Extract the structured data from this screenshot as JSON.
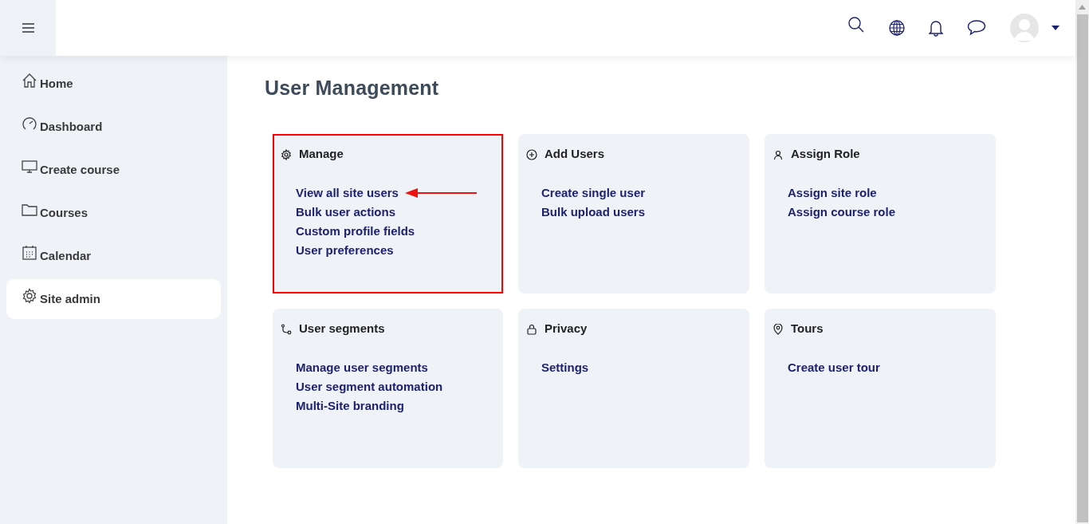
{
  "sidebar": {
    "items": [
      {
        "label": "Home",
        "selected": false
      },
      {
        "label": "Dashboard",
        "selected": false
      },
      {
        "label": "Create course",
        "selected": false
      },
      {
        "label": "Courses",
        "selected": false
      },
      {
        "label": "Calendar",
        "selected": false
      },
      {
        "label": "Site admin",
        "selected": true
      }
    ]
  },
  "page": {
    "title": "User Management"
  },
  "cards": [
    {
      "title": "Manage",
      "highlighted": true,
      "links": [
        {
          "label": "View all site users",
          "pointer_arrow": true
        },
        {
          "label": "Bulk user actions",
          "pointer_arrow": false
        },
        {
          "label": "Custom profile fields",
          "pointer_arrow": false
        },
        {
          "label": "User preferences",
          "pointer_arrow": false
        }
      ]
    },
    {
      "title": "Add Users",
      "highlighted": false,
      "links": [
        {
          "label": "Create single user",
          "pointer_arrow": false
        },
        {
          "label": "Bulk upload users",
          "pointer_arrow": false
        }
      ]
    },
    {
      "title": "Assign Role",
      "highlighted": false,
      "links": [
        {
          "label": "Assign site role",
          "pointer_arrow": false
        },
        {
          "label": "Assign course role",
          "pointer_arrow": false
        }
      ]
    },
    {
      "title": "User segments",
      "highlighted": false,
      "links": [
        {
          "label": "Manage user segments",
          "pointer_arrow": false
        },
        {
          "label": "User segment automation",
          "pointer_arrow": false
        },
        {
          "label": "Multi-Site branding",
          "pointer_arrow": false
        }
      ]
    },
    {
      "title": "Privacy",
      "highlighted": false,
      "links": [
        {
          "label": "Settings",
          "pointer_arrow": false
        }
      ]
    },
    {
      "title": "Tours",
      "highlighted": false,
      "links": [
        {
          "label": "Create user tour",
          "pointer_arrow": false
        }
      ]
    }
  ]
}
